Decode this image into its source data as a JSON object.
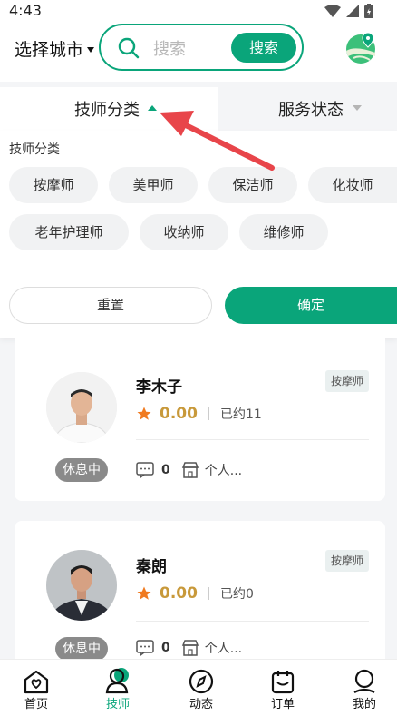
{
  "status_bar": {
    "time": "4:43"
  },
  "header": {
    "city_label": "选择城市",
    "search_placeholder": "搜索",
    "search_button": "搜索"
  },
  "filter_tabs": [
    {
      "label": "技师分类",
      "expanded": true
    },
    {
      "label": "服务状态",
      "expanded": false
    }
  ],
  "category_panel": {
    "title": "技师分类",
    "chips": [
      "按摩师",
      "美甲师",
      "保洁师",
      "化妆师",
      "老年护理师",
      "收纳师",
      "维修师"
    ],
    "reset_label": "重置",
    "confirm_label": "确定"
  },
  "technicians": [
    {
      "name": "李木子",
      "tag": "按摩师",
      "rating": "0.00",
      "booked": "已约11",
      "status": "休息中",
      "comments": "0",
      "shop": "个人..."
    },
    {
      "name": "秦朗",
      "tag": "按摩师",
      "rating": "0.00",
      "booked": "已约0",
      "status": "休息中",
      "comments": "0",
      "shop": "个人..."
    }
  ],
  "bottom_nav": [
    {
      "label": "首页",
      "icon": "home-icon",
      "active": false
    },
    {
      "label": "技师",
      "icon": "technician-icon",
      "active": true
    },
    {
      "label": "动态",
      "icon": "compass-icon",
      "active": false
    },
    {
      "label": "订单",
      "icon": "order-icon",
      "active": false
    },
    {
      "label": "我的",
      "icon": "profile-icon",
      "active": false
    }
  ],
  "colors": {
    "accent": "#0aa57a",
    "rating": "#c8993a",
    "star": "#f07a20",
    "arrow": "#e8454a"
  }
}
